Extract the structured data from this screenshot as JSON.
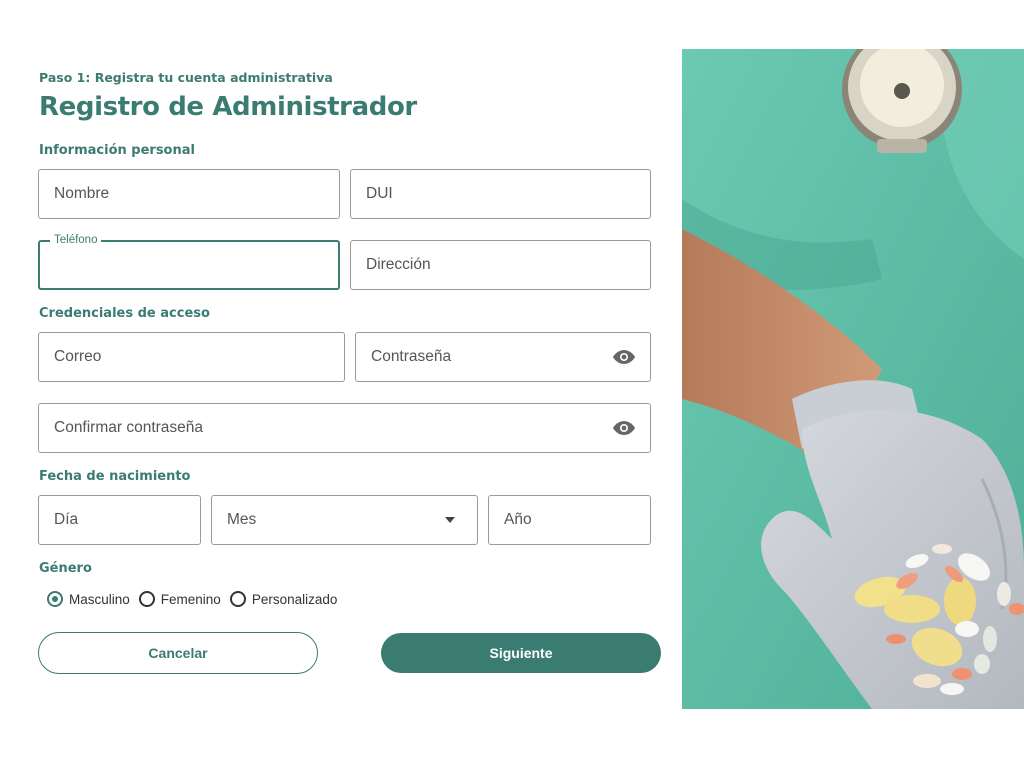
{
  "header": {
    "step": "Paso 1: Registra tu cuenta administrativa",
    "title": "Registro de Administrador"
  },
  "sections": {
    "personal": "Información personal",
    "credentials": "Credenciales de acceso",
    "birthdate": "Fecha de nacimiento",
    "gender": "Género"
  },
  "fields": {
    "nombre": "Nombre",
    "dui": "DUI",
    "telefono_label": "Teléfono",
    "telefono_value": "",
    "direccion": "Dirección",
    "correo": "Correo",
    "contrasena": "Contraseña",
    "confirmar": "Confirmar contraseña",
    "dia": "Día",
    "mes": "Mes",
    "anio": "Año"
  },
  "gender_options": [
    {
      "label": "Masculino",
      "checked": true
    },
    {
      "label": "Femenino",
      "checked": false
    },
    {
      "label": "Personalizado",
      "checked": false
    }
  ],
  "buttons": {
    "cancel": "Cancelar",
    "next": "Siguiente"
  },
  "icons": {
    "password_toggle": "eye-icon",
    "select_caret": "caret-down-icon"
  },
  "colors": {
    "accent": "#3b7c72",
    "border": "#9a9a9a",
    "photo_scrubs": "#5fc0a8"
  }
}
